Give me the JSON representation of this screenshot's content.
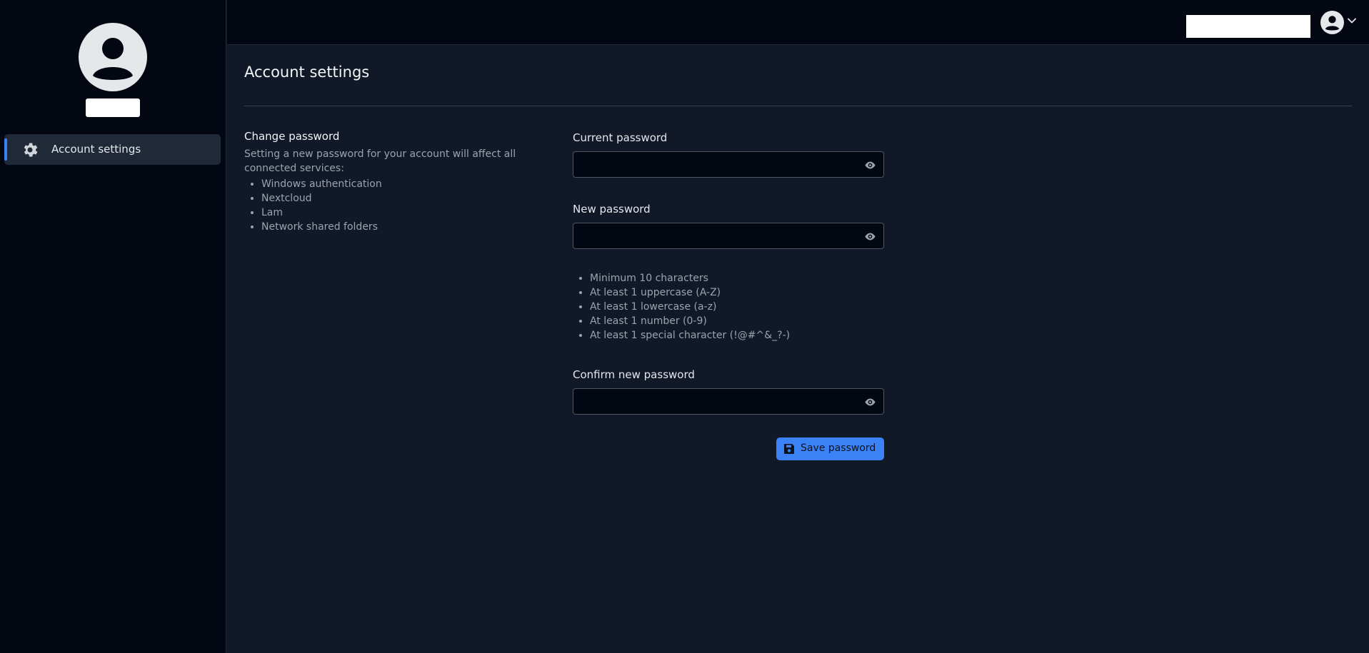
{
  "sidebar": {
    "items": [
      {
        "label": "Account settings",
        "icon": "gear-icon",
        "active": true
      }
    ]
  },
  "main": {
    "title": "Account settings",
    "section": {
      "title": "Change password",
      "description": "Setting a new password for your account will affect all connected services:",
      "services": [
        "Windows authentication",
        "Nextcloud",
        "Lam",
        "Network shared folders"
      ]
    },
    "fields": {
      "current": {
        "label": "Current password",
        "value": ""
      },
      "new": {
        "label": "New password",
        "value": ""
      },
      "confirm": {
        "label": "Confirm new password",
        "value": ""
      }
    },
    "rules": [
      "Minimum 10 characters",
      "At least 1 uppercase (A-Z)",
      "At least 1 lowercase (a-z)",
      "At least 1 number (0-9)",
      "At least 1 special character (!@#^&_?-)"
    ],
    "save_label": "Save password"
  },
  "colors": {
    "accent": "#3b82f6",
    "sidebar_bg": "#030712",
    "main_bg": "#111827"
  }
}
